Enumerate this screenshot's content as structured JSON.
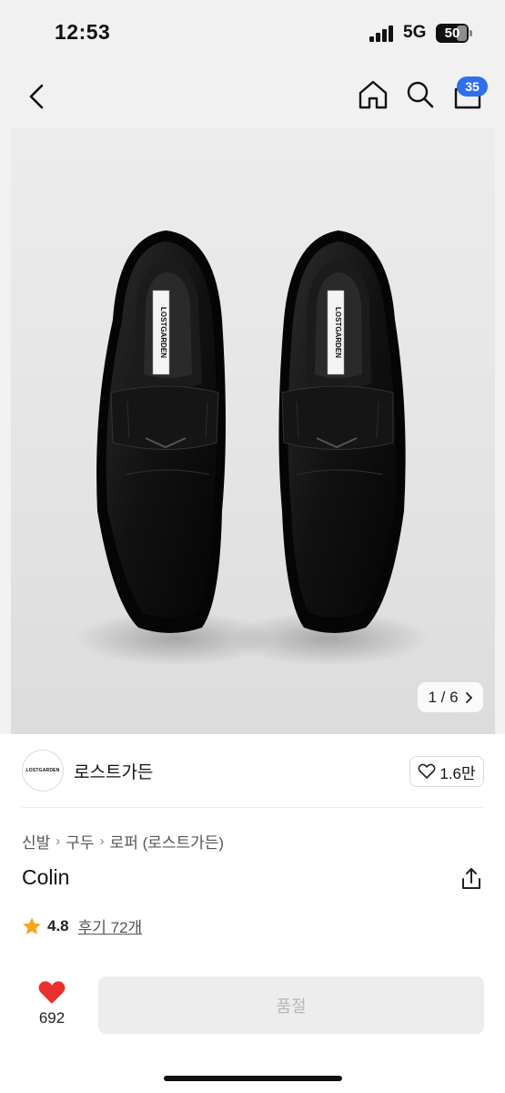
{
  "status_bar": {
    "time": "12:53",
    "network": "5G",
    "battery": "50"
  },
  "nav": {
    "cart_count": "35"
  },
  "gallery": {
    "counter": "1 / 6",
    "shoe_label_text": "LOSTGARDEN"
  },
  "brand": {
    "logo_text": "LOSTGARDEN",
    "name": "로스트가든",
    "like_count": "1.6만"
  },
  "product": {
    "breadcrumb": [
      "신발",
      "구두",
      "로퍼 (로스트가든)"
    ],
    "title": "Colin",
    "rating": "4.8",
    "reviews": "후기 72개"
  },
  "purchase_bar": {
    "like_count": "692",
    "button_label": "품절"
  },
  "colors": {
    "badge": "#2f6fed",
    "heart": "#e8312f",
    "star": "#f5a623"
  }
}
